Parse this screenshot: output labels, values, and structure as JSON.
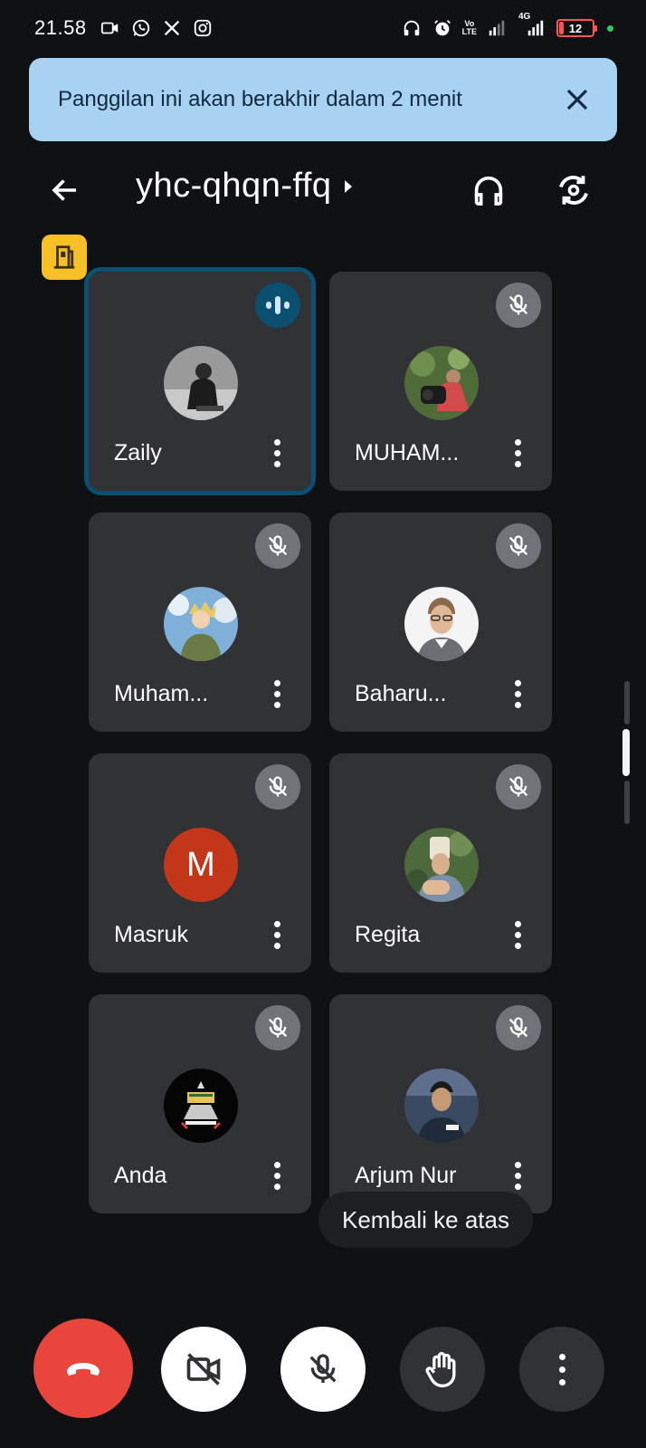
{
  "status_bar": {
    "time": "21.58",
    "volte_top": "Vo",
    "volte_bottom": "LTE",
    "network": "4G",
    "battery": "12",
    "icons_left": [
      "video-icon",
      "whatsapp-icon",
      "x-icon",
      "instagram-icon"
    ],
    "icons_right": [
      "headphones-icon",
      "alarm-icon",
      "volte-icon",
      "signal-icon",
      "signal-4g-icon",
      "battery-icon"
    ]
  },
  "banner": {
    "text": "Panggilan ini akan berakhir dalam 2 menit",
    "close_icon": "close-icon"
  },
  "header": {
    "meeting_code": "yhc-qhqn-ffq",
    "back_icon": "arrow-left-icon",
    "audio_icon": "headphones-icon",
    "switch_camera_icon": "switch-camera-icon",
    "host_icon": "door-icon"
  },
  "participants": [
    {
      "name": "Zaily",
      "state": "speaking",
      "avatar": "photo"
    },
    {
      "name": "MUHAM...",
      "state": "muted",
      "avatar": "photo"
    },
    {
      "name": "Muham...",
      "state": "muted",
      "avatar": "photo"
    },
    {
      "name": "Baharu...",
      "state": "muted",
      "avatar": "photo"
    },
    {
      "name": "Masruk",
      "state": "muted",
      "avatar": "letter",
      "initial": "M"
    },
    {
      "name": "Regita",
      "state": "muted",
      "avatar": "photo"
    },
    {
      "name": "Anda",
      "state": "muted",
      "avatar": "photo"
    },
    {
      "name": "Arjum Nur",
      "state": "muted",
      "avatar": "photo"
    }
  ],
  "back_to_top": "Kembali ke atas",
  "controls": {
    "end_call": "end-call-icon",
    "camera": "camera-off-icon",
    "mic": "mic-off-icon",
    "raise_hand": "hand-icon",
    "more": "more-vert-icon"
  },
  "colors": {
    "background": "#0f1115",
    "tile": "#303236",
    "banner": "#a8d1f2",
    "end_call": "#e8453c",
    "active_outline": "#0b4f71",
    "host_badge": "#f6c026",
    "letter_avatar": "#c4361a"
  }
}
